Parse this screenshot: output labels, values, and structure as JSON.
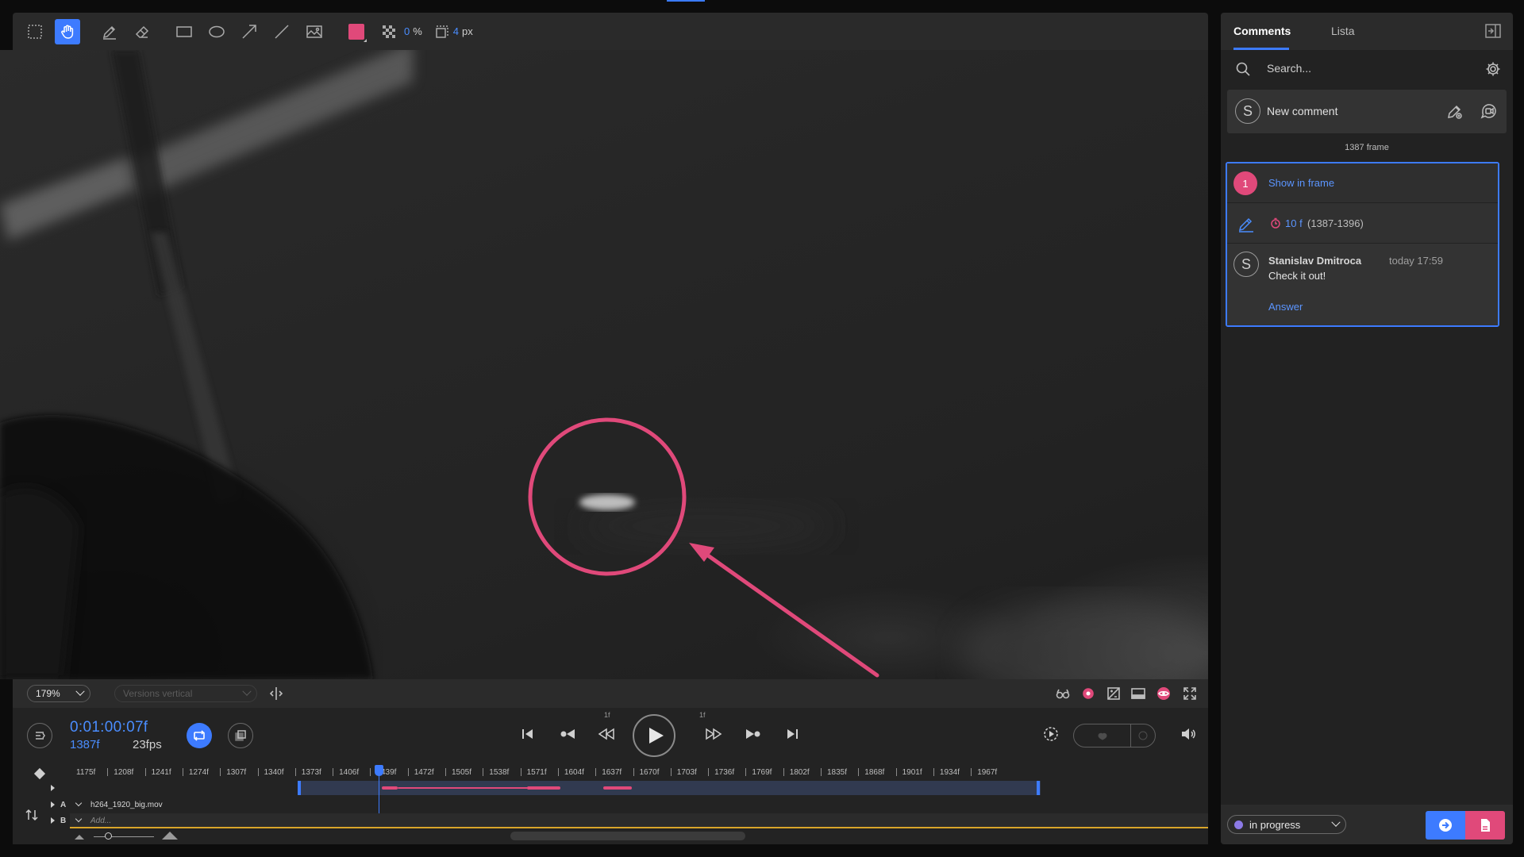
{
  "toolbar": {
    "opacity_value": "0",
    "opacity_unit": "%",
    "stroke_value": "4",
    "stroke_unit": "px",
    "color": "#e0497a",
    "tools": [
      "select-rect-icon",
      "hand-icon",
      "pen-icon",
      "eraser-icon",
      "rectangle-icon",
      "ellipse-icon",
      "arrow-icon",
      "line-icon",
      "image-icon"
    ]
  },
  "viewer_bar": {
    "zoom": "179%",
    "versions_placeholder": "Versions vertical"
  },
  "player": {
    "timecode": "0:01:00:07f",
    "frame": "1387f",
    "fps": "23fps",
    "step_back_label": "1f",
    "step_fwd_label": "1f"
  },
  "timeline": {
    "ticks": [
      "1175f",
      "1208f",
      "1241f",
      "1274f",
      "1307f",
      "1340f",
      "1373f",
      "1406f",
      "1439f",
      "1472f",
      "1505f",
      "1538f",
      "1571f",
      "1604f",
      "1637f",
      "1670f",
      "1703f",
      "1736f",
      "1769f",
      "1802f",
      "1835f",
      "1868f",
      "1901f",
      "1934f",
      "1967f"
    ],
    "track_a_letter": "A",
    "track_a_name": "h264_1920_big.mov",
    "track_b_letter": "B",
    "track_b_name": "Add..."
  },
  "panel": {
    "tab_comments": "Comments",
    "tab_lista": "Lista",
    "search_placeholder": "Search...",
    "avatar_initial": "S",
    "new_comment": "New comment",
    "frame_header": "1387 frame",
    "comment": {
      "number": "1",
      "show_in_frame": "Show in frame",
      "duration": "10 f",
      "range": "(1387-1396)",
      "author_initial": "S",
      "author": "Stanislav Dmitroca",
      "time": "today 17:59",
      "text": "Check it out!",
      "answer": "Answer"
    },
    "status": "in progress",
    "accent_blue": "#3d7bff",
    "accent_pink": "#e0497a"
  }
}
